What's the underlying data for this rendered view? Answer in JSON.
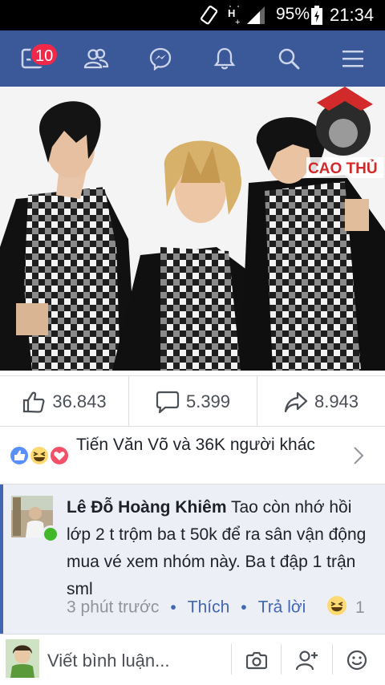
{
  "status_bar": {
    "battery": "95%",
    "time": "21:34",
    "network": "H+"
  },
  "nav": {
    "items": [
      "news-feed",
      "friends",
      "messenger",
      "notifications",
      "search",
      "menu"
    ],
    "badge_count": "10"
  },
  "photo": {
    "watermark": "CAO THỦ"
  },
  "actions": {
    "likes": "36.843",
    "comments": "5.399",
    "shares": "8.943"
  },
  "reactions": {
    "text": "Tiến Văn Võ và 36K người khác"
  },
  "comment": {
    "author": "Lê Đỗ Hoàng Khiêm",
    "text": "Tao còn nhớ hồi lớp 2 t trộm ba t 50k để ra sân vận động mua vé xem nhóm này. Ba t đập 1 trận sml",
    "time": "3 phút trước",
    "like_label": "Thích",
    "reply_label": "Trả lời",
    "reaction_count": "1"
  },
  "composer": {
    "placeholder": "Viết bình luận..."
  },
  "colors": {
    "brand": "#3b5998",
    "badge": "#f02849",
    "link": "#4267b2",
    "online": "#42b72a"
  }
}
